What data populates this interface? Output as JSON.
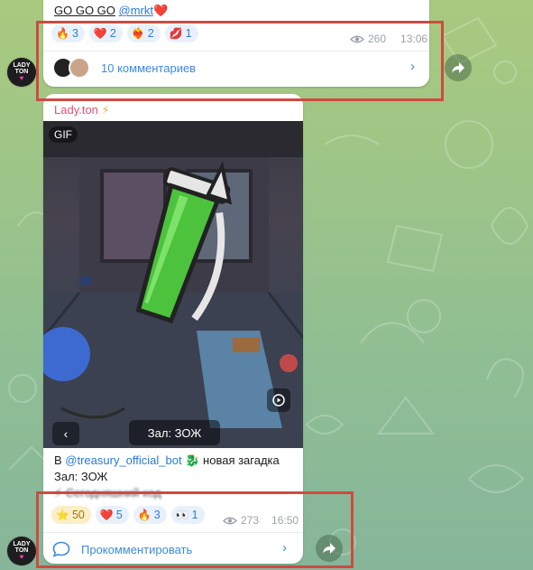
{
  "top_message": {
    "text_link_1": "GO GO GO",
    "text_link_2": "@mrkt",
    "text_heart": "❤️",
    "reactions": [
      {
        "emoji": "🔥",
        "count": "3",
        "active": false
      },
      {
        "emoji": "❤️",
        "count": "2",
        "active": false
      },
      {
        "emoji": "❤️‍🔥",
        "count": "2",
        "active": false
      },
      {
        "emoji": "💋",
        "count": "1",
        "active": false
      }
    ],
    "views": "260",
    "time": "13:06",
    "comments_label": "10 комментариев"
  },
  "bottom_message": {
    "author": "Lady.ton",
    "author_badge": "⚡",
    "media_badge": "GIF",
    "media_caption": "Зал: ЗОЖ",
    "text_prefix": "В",
    "text_mention": "@treasury_official_bot",
    "text_suffix": "новая загадка",
    "text_emoji": "🐉",
    "text_line2": "Зал: ЗОЖ",
    "text_line3_partial": "⚡ Сегодняшний код",
    "reactions": [
      {
        "emoji": "⭐",
        "count": "50",
        "style": "yellow"
      },
      {
        "emoji": "❤️",
        "count": "5",
        "style": "plain"
      },
      {
        "emoji": "🔥",
        "count": "3",
        "style": "plain"
      },
      {
        "emoji": "👀",
        "count": "1",
        "style": "plain"
      }
    ],
    "views": "273",
    "time": "16:50",
    "comment_label": "Прокомментировать"
  },
  "channel_avatar": {
    "line1": "LADY",
    "line2": "TON",
    "heart": "♥"
  },
  "colors": {
    "accent": "#3a8be0",
    "author": "#e0517b",
    "highlight_box": "#cf4a41"
  }
}
